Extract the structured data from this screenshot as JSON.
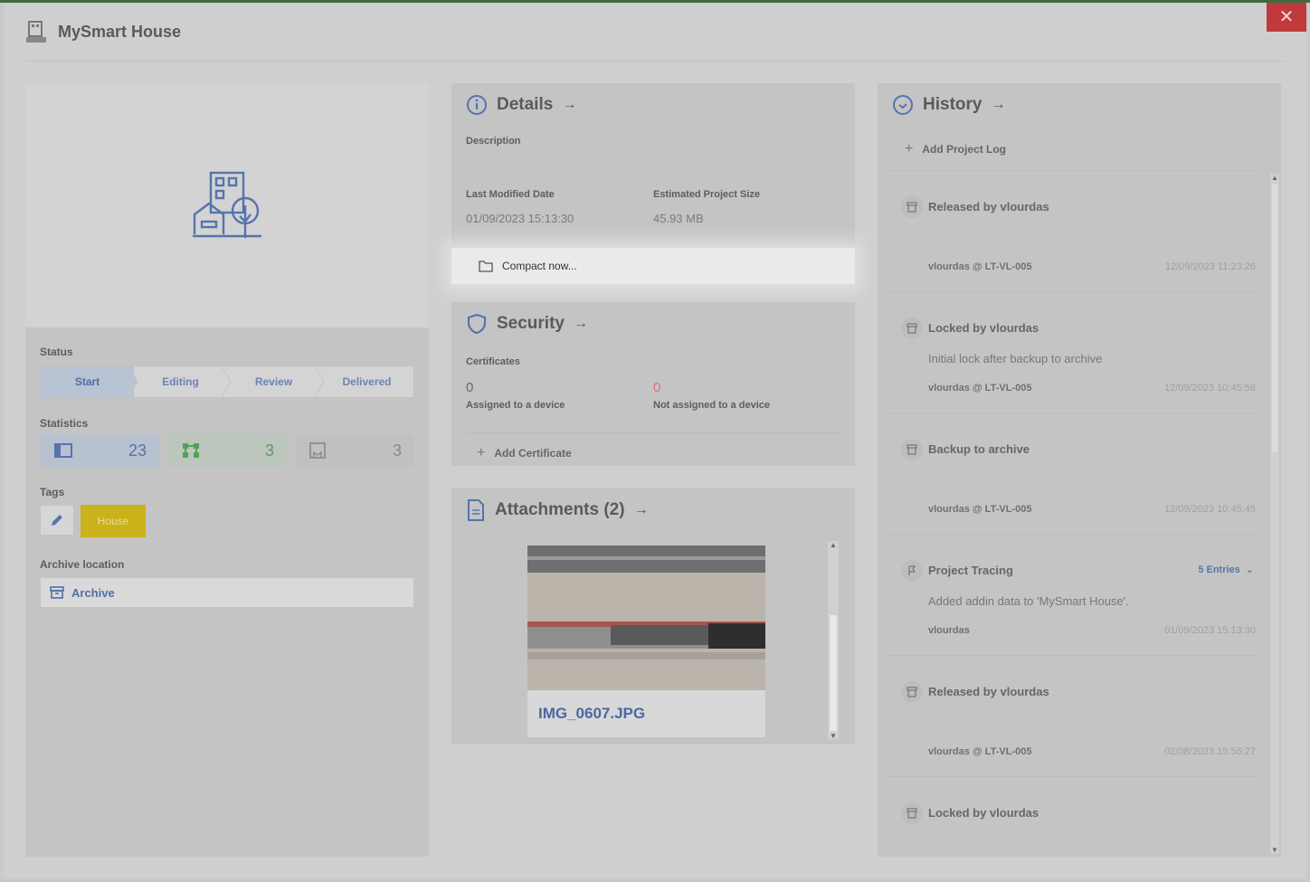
{
  "window": {
    "title": "MySmart House",
    "close_label": "✕"
  },
  "left": {
    "status_label": "Status",
    "steps": [
      "Start",
      "Editing",
      "Review",
      "Delivered"
    ],
    "statistics_label": "Statistics",
    "stats": [
      {
        "icon": "panel-icon",
        "value": "23"
      },
      {
        "icon": "network-icon",
        "value": "3"
      },
      {
        "icon": "bookmark-icon",
        "value": "3"
      }
    ],
    "tags_label": "Tags",
    "tag": "House",
    "archive_location_label": "Archive location",
    "archive_value": "Archive"
  },
  "details": {
    "title": "Details",
    "description_label": "Description",
    "last_modified_label": "Last Modified Date",
    "last_modified_value": "01/09/2023 15:13:30",
    "size_label": "Estimated Project Size",
    "size_value": "45.93 MB",
    "compact_label": "Compact now..."
  },
  "security": {
    "title": "Security",
    "certificates_label": "Certificates",
    "assigned_count": "0",
    "assigned_label": "Assigned to a device",
    "unassigned_count": "0",
    "unassigned_label": "Not assigned to a device",
    "add_certificate_label": "Add Certificate"
  },
  "attachments": {
    "title": "Attachments (2)",
    "file_name": "IMG_0607.JPG"
  },
  "history": {
    "title": "History",
    "add_log_label": "Add Project Log",
    "entries": [
      {
        "title": "Released by vlourdas",
        "desc": "",
        "user": "vlourdas @ LT-VL-005",
        "time": "12/09/2023 11:23:26"
      },
      {
        "title": "Locked by vlourdas",
        "desc": "Initial lock after backup to archive",
        "user": "vlourdas @ LT-VL-005",
        "time": "12/09/2023 10:45:58"
      },
      {
        "title": "Backup to archive",
        "desc": "",
        "user": "vlourdas @ LT-VL-005",
        "time": "12/09/2023 10:45:45"
      },
      {
        "title": "Project Tracing",
        "desc": "Added addin data to 'MySmart House'.",
        "user": "vlourdas",
        "time": "01/09/2023 15:13:30",
        "extra": "5 Entries"
      },
      {
        "title": "Released by vlourdas",
        "desc": "",
        "user": "vlourdas @ LT-VL-005",
        "time": "02/08/2023 15:56:27"
      },
      {
        "title": "Locked by vlourdas",
        "desc": "",
        "user": "",
        "time": ""
      }
    ]
  },
  "colors": {
    "accent": "#4e6fa7",
    "close": "#c0393b",
    "tag": "#cbb21a",
    "warning": "#e07070"
  }
}
